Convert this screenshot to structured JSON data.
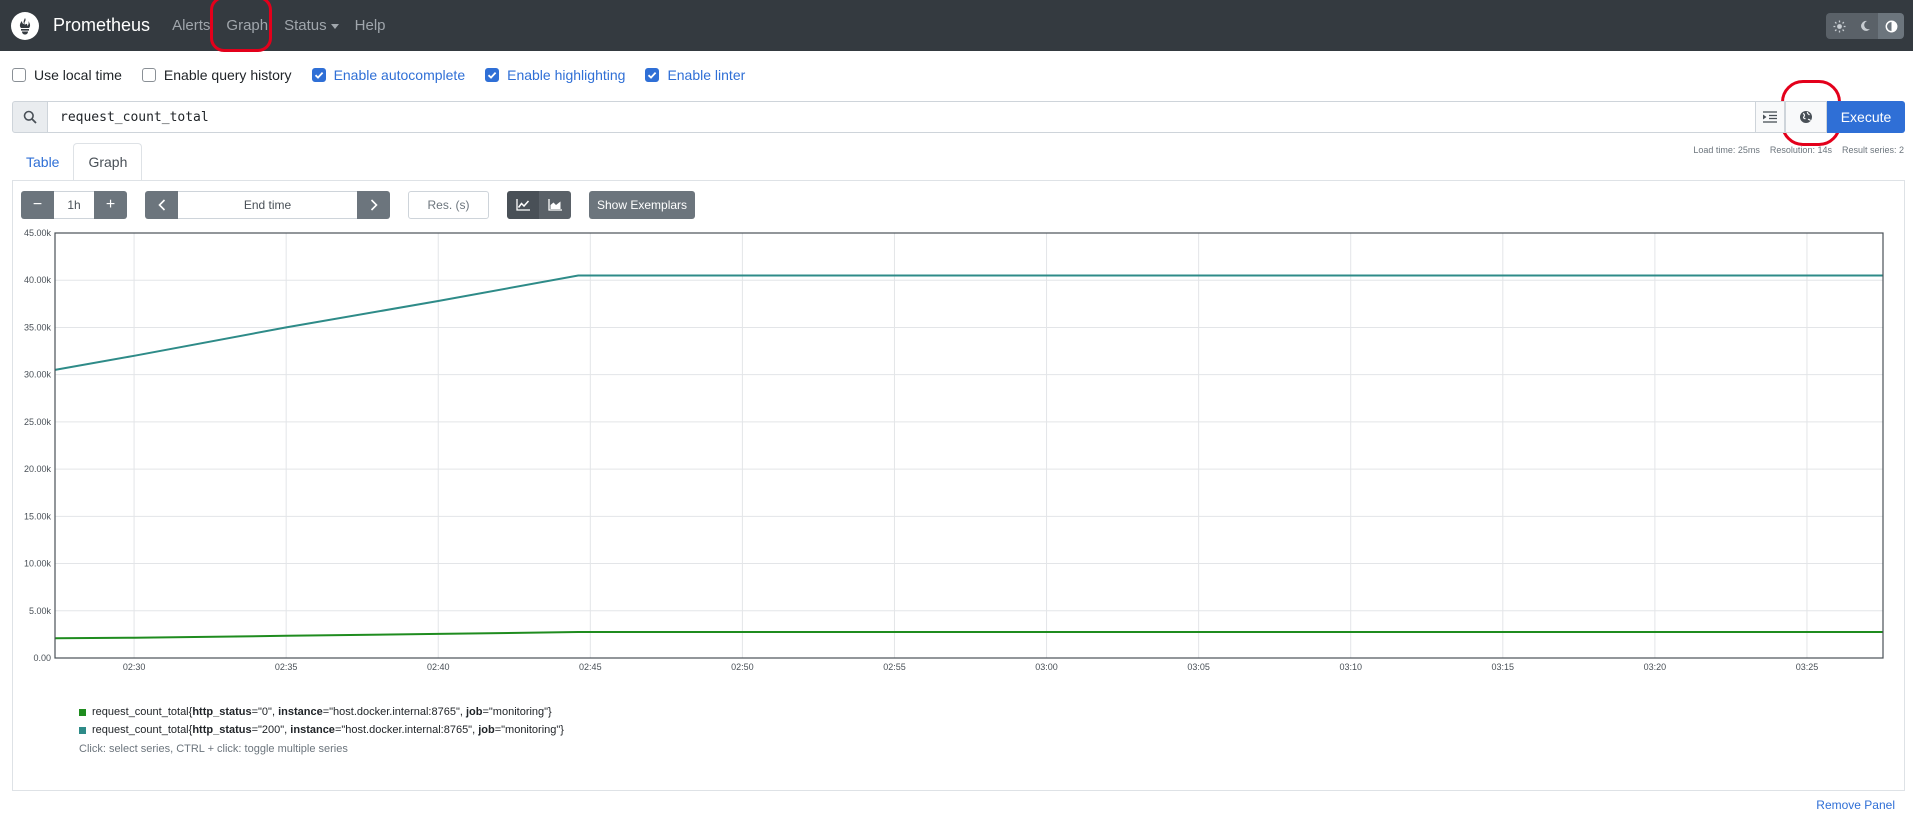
{
  "navbar": {
    "brand": "Prometheus",
    "items": [
      {
        "label": "Alerts"
      },
      {
        "label": "Graph"
      },
      {
        "label": "Status"
      },
      {
        "label": "Help"
      }
    ]
  },
  "options": [
    {
      "label": "Use local time",
      "checked": false
    },
    {
      "label": "Enable query history",
      "checked": false
    },
    {
      "label": "Enable autocomplete",
      "checked": true
    },
    {
      "label": "Enable highlighting",
      "checked": true
    },
    {
      "label": "Enable linter",
      "checked": true
    }
  ],
  "query": {
    "expression": "request_count_total",
    "execute_label": "Execute"
  },
  "stats": {
    "load_time": "Load time: 25ms",
    "resolution": "Resolution: 14s",
    "result_series": "Result series: 2"
  },
  "tabs": [
    {
      "label": "Table",
      "active": false
    },
    {
      "label": "Graph",
      "active": true
    }
  ],
  "controls": {
    "minus": "−",
    "range": "1h",
    "plus": "+",
    "end_time_placeholder": "End time",
    "resolution_placeholder": "Res. (s)",
    "exemplars_label": "Show Exemplars"
  },
  "colors": {
    "accent": "#2f6fd6",
    "navbar": "#343a40",
    "series_0": "#1f8c1f",
    "series_200": "#2e8b88"
  },
  "chart_data": {
    "type": "line",
    "y_ticks": [
      "0.00",
      "5.00k",
      "10.00k",
      "15.00k",
      "20.00k",
      "25.00k",
      "30.00k",
      "35.00k",
      "40.00k",
      "45.00k"
    ],
    "x_ticks": [
      "02:30",
      "02:35",
      "02:40",
      "02:45",
      "02:50",
      "02:55",
      "03:00",
      "03:05",
      "03:10",
      "03:15",
      "03:20",
      "03:25"
    ],
    "x_range_minutes": [
      -2.6,
      57.5
    ],
    "ylim": [
      0,
      45000
    ],
    "grid": true,
    "series": [
      {
        "labels": {
          "prefix": "request_count_total{",
          "k1": "http_status",
          "v1": "=\"0\", ",
          "k2": "instance",
          "v2": "=\"host.docker.internal:8765\", ",
          "k3": "job",
          "v3": "=\"monitoring\"}"
        },
        "x_minutes": [
          -2.6,
          0,
          5,
          10,
          14.6,
          20,
          30,
          40,
          50,
          57.5
        ],
        "values": [
          2100,
          2150,
          2350,
          2550,
          2750,
          2750,
          2750,
          2750,
          2750,
          2750
        ]
      },
      {
        "labels": {
          "prefix": "request_count_total{",
          "k1": "http_status",
          "v1": "=\"200\", ",
          "k2": "instance",
          "v2": "=\"host.docker.internal:8765\", ",
          "k3": "job",
          "v3": "=\"monitoring\"}"
        },
        "x_minutes": [
          -2.6,
          0,
          5,
          10,
          14.6,
          20,
          30,
          40,
          50,
          57.5
        ],
        "values": [
          30500,
          32000,
          35000,
          37800,
          40500,
          40500,
          40500,
          40500,
          40500,
          40500
        ]
      }
    ]
  },
  "legend_hint": "Click: select series, CTRL + click: toggle multiple series",
  "remove_panel": "Remove Panel"
}
